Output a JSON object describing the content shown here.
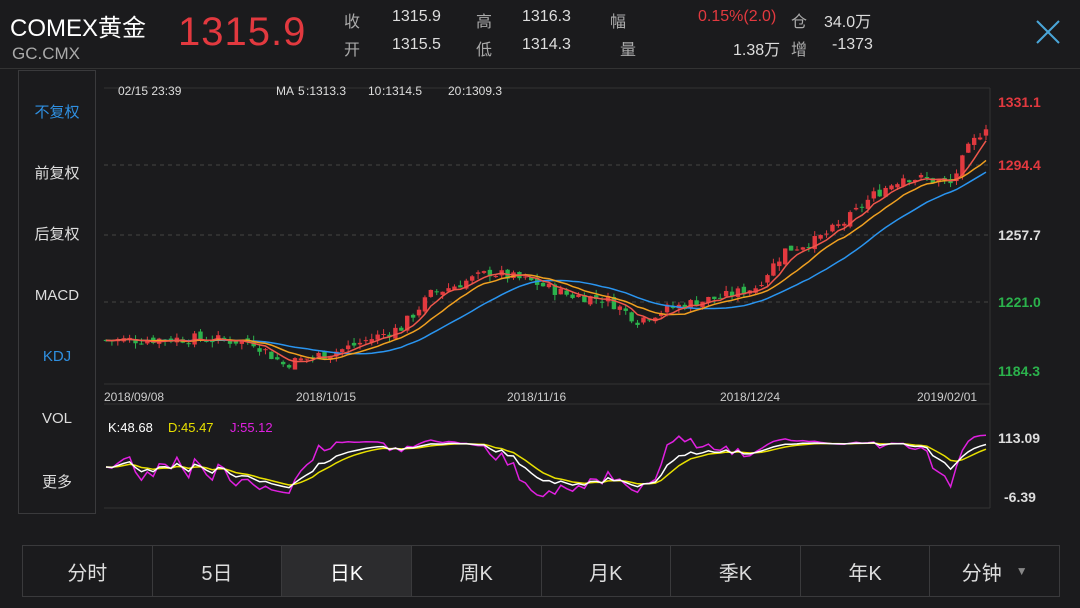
{
  "header": {
    "symbol": "COMEX黄金",
    "code": "GC.CMX",
    "price": "1315.9",
    "quotes": [
      {
        "k": "收",
        "v": "1315.9"
      },
      {
        "k": "开",
        "v": "1315.5"
      },
      {
        "k": "高",
        "v": "1316.3"
      },
      {
        "k": "低",
        "v": "1314.3"
      },
      {
        "k": "幅",
        "v": "0.15%(2.0)"
      },
      {
        "k": "量",
        "v": "1.38万"
      },
      {
        "k": "仓",
        "v": "34.0万"
      },
      {
        "k": "增",
        "v": "-1373"
      }
    ]
  },
  "sidebar": {
    "items": [
      {
        "label": "不复权",
        "active": true
      },
      {
        "label": "前复权"
      },
      {
        "label": "后复权"
      },
      {
        "label": "MACD"
      },
      {
        "label": "KDJ",
        "active": true
      },
      {
        "label": "VOL"
      },
      {
        "label": "更多"
      }
    ]
  },
  "chart": {
    "date": "02/15 23:39",
    "ma_label": "MA",
    "ma": [
      {
        "p": "5",
        "v": ":1313.3",
        "c": "#f0574b"
      },
      {
        "p": "10",
        "v": ":1314.5",
        "c": "#f0a020"
      },
      {
        "p": "20",
        "v": ":1309.3",
        "c": "#2a95f0"
      }
    ],
    "y_labels": [
      {
        "v": "1331.1",
        "c": "#e2393f"
      },
      {
        "v": "1294.4",
        "c": "#e2393f"
      },
      {
        "v": "1257.7",
        "c": "#dddddd"
      },
      {
        "v": "1221.0",
        "c": "#2bb24c"
      },
      {
        "v": "1184.3",
        "c": "#2bb24c"
      }
    ],
    "x_labels": [
      "2018/09/08",
      "2018/10/15",
      "2018/11/16",
      "2018/12/24",
      "2019/02/01"
    ]
  },
  "kdj": {
    "k": "K:48.68",
    "d": "D:45.47",
    "j": "J:55.12",
    "max": "113.09",
    "min": "-6.39"
  },
  "tabs": [
    {
      "label": "分时"
    },
    {
      "label": "5日"
    },
    {
      "label": "日K",
      "active": true
    },
    {
      "label": "周K"
    },
    {
      "label": "月K"
    },
    {
      "label": "季K"
    },
    {
      "label": "年K"
    },
    {
      "label": "分钟",
      "dropdown": true
    }
  ],
  "colors": {
    "up": "#e2393f",
    "down": "#2bb24c",
    "accent": "#2f8fe0",
    "ma5": "#f0574b",
    "ma10": "#f0a020",
    "ma20": "#2a95f0",
    "k": "#ffffff",
    "d": "#e8e000",
    "j": "#e020e0"
  }
}
